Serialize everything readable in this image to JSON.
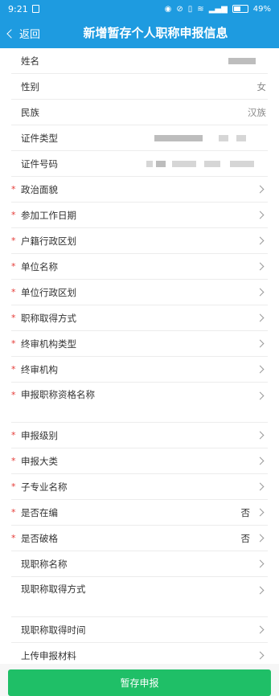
{
  "status_bar": {
    "time": "9:21",
    "battery": "49%"
  },
  "header": {
    "back_label": "返回",
    "title": "新增暂存个人职称申报信息"
  },
  "form": {
    "rows": [
      {
        "label": "姓名",
        "value": "",
        "required": false,
        "arrow": false
      },
      {
        "label": "性别",
        "value": "女",
        "required": false,
        "arrow": false
      },
      {
        "label": "民族",
        "value": "汉族",
        "required": false,
        "arrow": false
      },
      {
        "label": "证件类型",
        "value": "",
        "required": false,
        "arrow": false
      },
      {
        "label": "证件号码",
        "value": "",
        "required": false,
        "arrow": false
      },
      {
        "label": "政治面貌",
        "value": "",
        "required": true,
        "arrow": true
      },
      {
        "label": "参加工作日期",
        "value": "",
        "required": true,
        "arrow": true
      },
      {
        "label": "户籍行政区划",
        "value": "",
        "required": true,
        "arrow": true
      },
      {
        "label": "单位名称",
        "value": "",
        "required": true,
        "arrow": true
      },
      {
        "label": "单位行政区划",
        "value": "",
        "required": true,
        "arrow": true
      },
      {
        "label": "职称取得方式",
        "value": "",
        "required": true,
        "arrow": true
      },
      {
        "label": "终审机构类型",
        "value": "",
        "required": true,
        "arrow": true
      },
      {
        "label": "终审机构",
        "value": "",
        "required": true,
        "arrow": true
      },
      {
        "label": "申报职称资格名称",
        "value": "",
        "required": true,
        "arrow": true
      },
      {
        "label": "申报级别",
        "value": "",
        "required": true,
        "arrow": true
      },
      {
        "label": "申报大类",
        "value": "",
        "required": true,
        "arrow": true
      },
      {
        "label": "子专业名称",
        "value": "",
        "required": true,
        "arrow": true
      },
      {
        "label": "是否在编",
        "value": "否",
        "required": true,
        "arrow": true
      },
      {
        "label": "是否破格",
        "value": "否",
        "required": true,
        "arrow": true
      },
      {
        "label": "现职称名称",
        "value": "",
        "required": false,
        "arrow": true
      },
      {
        "label": "现职称取得方式",
        "value": "",
        "required": false,
        "arrow": true
      },
      {
        "label": "现职称取得时间",
        "value": "",
        "required": false,
        "arrow": true
      },
      {
        "label": "上传申报材料",
        "value": "",
        "required": false,
        "arrow": true
      }
    ]
  },
  "required_marker": "*",
  "footer": {
    "submit_label": "暂存申报"
  },
  "colors": {
    "header": "#1e9be0",
    "required": "#e53935",
    "submit": "#1fbf67"
  },
  "icons": [
    "back-chevron-icon",
    "chevron-right-icon",
    "battery-icon",
    "wifi-icon",
    "signal-icon"
  ]
}
